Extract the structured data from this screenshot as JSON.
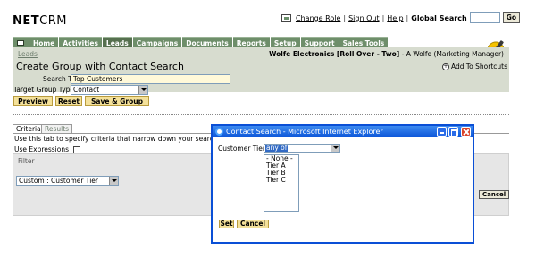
{
  "app": {
    "logo_bold": "NET",
    "logo_thin": "CRM"
  },
  "top_links": {
    "change_role": "Change Role",
    "sign_out": "Sign Out",
    "help": "Help",
    "separator": "|",
    "global_search_label": "Global Search",
    "global_search_value": "",
    "go_button": "Go"
  },
  "nav": {
    "tabs": [
      "Home",
      "Activities",
      "Leads",
      "Campaigns",
      "Documents",
      "Reports",
      "Setup",
      "Support",
      "Sales Tools"
    ],
    "active": "Leads"
  },
  "header": {
    "breadcrumb": "Leads",
    "company": "Wolfe Electronics [Roll Over - Two]",
    "user": " - A Wolfe (Marketing Manager)",
    "title": "Create Group with Contact Search",
    "add_shortcut": "Add To Shortcuts"
  },
  "form": {
    "search_title_label": "Search Title",
    "search_title_value": "Top Customers",
    "target_group_label": "Target Group Type",
    "target_group_value": "Contact",
    "preview_button": "Preview",
    "reset_button": "Reset",
    "save_group_button": "Save & Group"
  },
  "criteria": {
    "tab_criteria": "Criteria",
    "tab_results": "Results",
    "help_text": "Use this tab to specify criteria that narrow down your search.",
    "use_expressions_label": "Use Expressions",
    "filter_label": "Filter",
    "filter_select_value": "Custom : Customer Tier",
    "cancel_button": "Cancel"
  },
  "dialog": {
    "title": "Contact Search - Microsoft Internet Explorer",
    "field_label": "Customer Tier",
    "operator_value": "any of",
    "options": [
      "- None -",
      "Tier A",
      "Tier B",
      "Tier C"
    ],
    "set_button": "Set",
    "cancel_button": "Cancel"
  },
  "colors": {
    "nav_tab": "#6e8e6a",
    "header_band": "#d7dccf",
    "button_yellow": "#f4e19a",
    "dialog_border": "#0a4fd6"
  }
}
